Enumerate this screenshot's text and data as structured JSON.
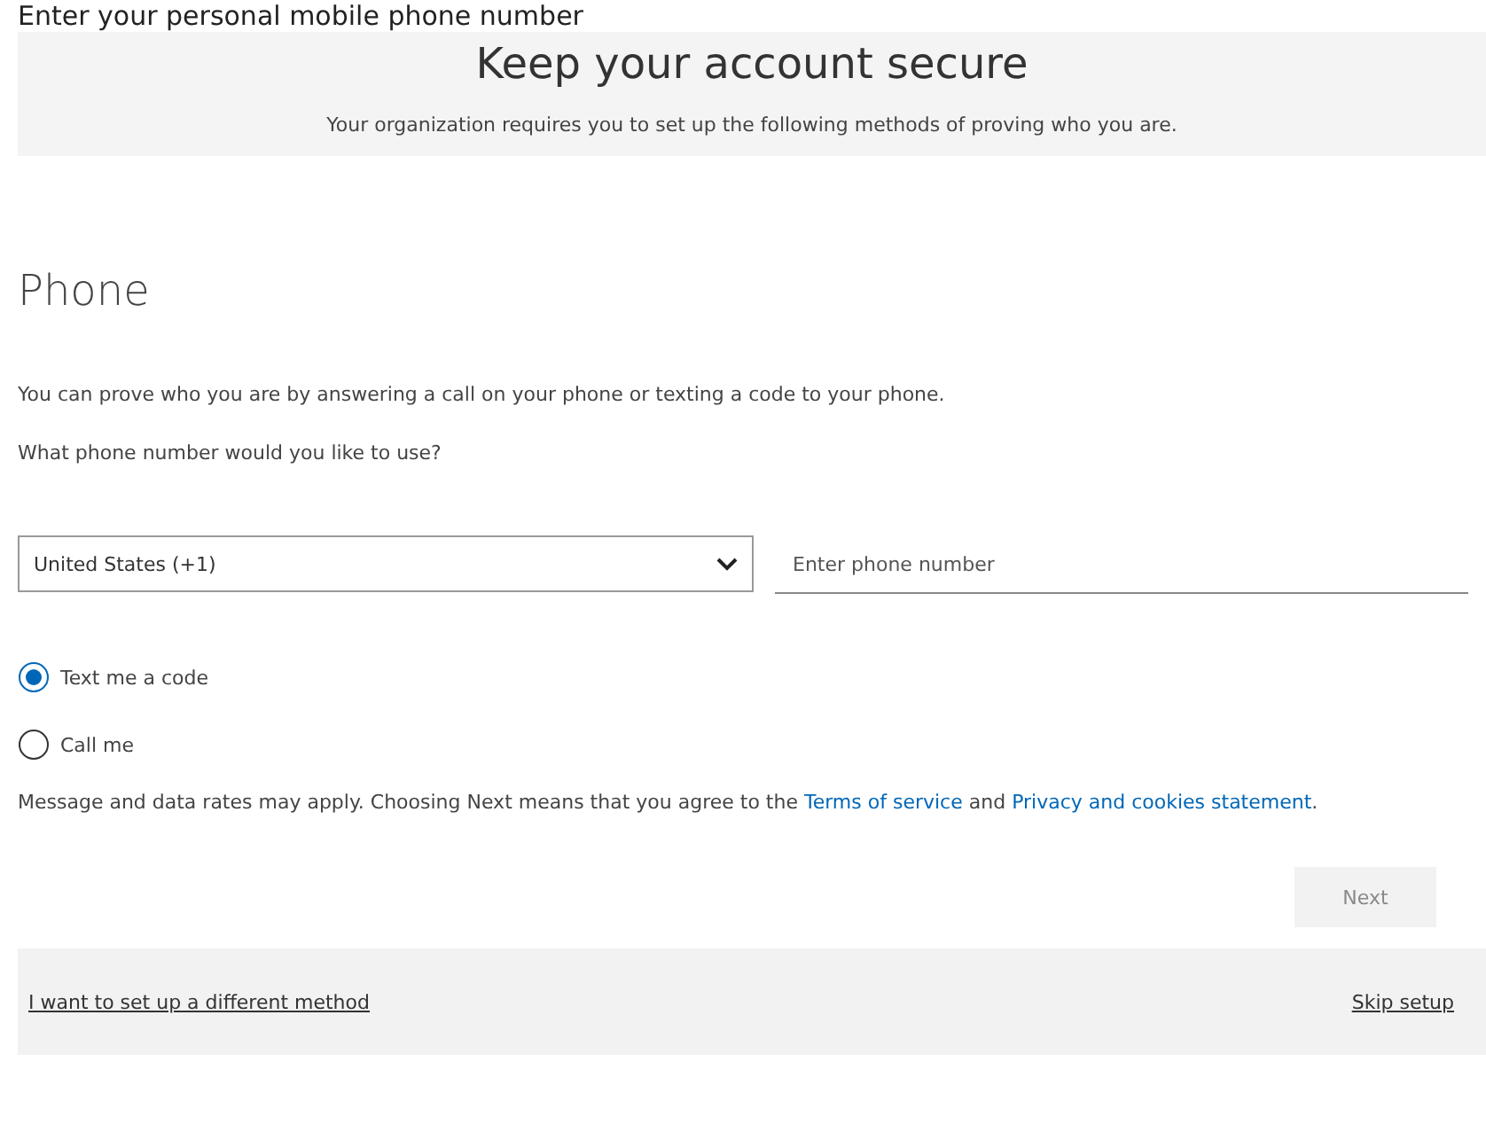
{
  "page_heading": "Enter your personal mobile phone number",
  "header": {
    "title": "Keep your account secure",
    "subtitle": "Your organization requires you to set up the following methods of proving who you are."
  },
  "method": {
    "title": "Phone",
    "description": "You can prove who you are by answering a call on your phone or texting a code to your phone.",
    "question": "What phone number would you like to use?"
  },
  "country_select": {
    "value": "United States (+1)"
  },
  "phone_field": {
    "placeholder": "Enter phone number"
  },
  "options": [
    {
      "label": "Text me a code",
      "selected": true
    },
    {
      "label": "Call me",
      "selected": false
    }
  ],
  "disclaimer": {
    "text": "Message and data rates may apply. Choosing Next means that you agree to the ",
    "link1": "Terms of service",
    "middle": " and ",
    "link2": "Privacy and cookies statement",
    "end": "."
  },
  "next_button": {
    "label": "Next",
    "disabled": true
  },
  "footer": {
    "left_link": "I want to set up a different method",
    "right_link": "Skip setup"
  }
}
